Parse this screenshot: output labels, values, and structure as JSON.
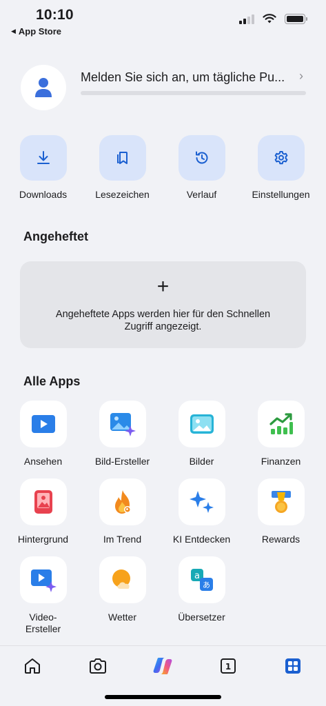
{
  "status_bar": {
    "time": "10:10",
    "back_app": "App Store"
  },
  "profile": {
    "signin_text": "Melden Sie sich an, um tägliche Pu...",
    "progress": 0
  },
  "quick_actions": [
    {
      "label": "Downloads",
      "icon": "download-icon"
    },
    {
      "label": "Lesezeichen",
      "icon": "bookmark-icon"
    },
    {
      "label": "Verlauf",
      "icon": "history-icon"
    },
    {
      "label": "Einstellungen",
      "icon": "gear-icon"
    }
  ],
  "pinned": {
    "title": "Angeheftet",
    "empty_text": "Angeheftete Apps werden hier für den Schnellen Zugriff angezeigt."
  },
  "apps": {
    "title": "Alle Apps",
    "items": [
      {
        "label": "Ansehen",
        "icon": "play-icon"
      },
      {
        "label": "Bild-Ersteller",
        "icon": "image-creator-icon"
      },
      {
        "label": "Bilder",
        "icon": "images-icon"
      },
      {
        "label": "Finanzen",
        "icon": "finance-chart-icon"
      },
      {
        "label": "Hintergrund",
        "icon": "wallpaper-icon"
      },
      {
        "label": "Im Trend",
        "icon": "flame-icon"
      },
      {
        "label": "KI Entdecken",
        "icon": "sparkle-icon"
      },
      {
        "label": "Rewards",
        "icon": "medal-icon"
      },
      {
        "label": "Video-\nErsteller",
        "icon": "video-creator-icon"
      },
      {
        "label": "Wetter",
        "icon": "weather-icon"
      },
      {
        "label": "Übersetzer",
        "icon": "translate-icon"
      }
    ]
  },
  "tabbar": {
    "tabs_count": "1",
    "items": [
      "home-icon",
      "camera-icon",
      "copilot-icon",
      "tabs-icon",
      "apps-grid-icon"
    ]
  },
  "colors": {
    "accent": "#1a73e8",
    "tile_blue": "#d9e4fa",
    "background": "#f1f2f6"
  }
}
